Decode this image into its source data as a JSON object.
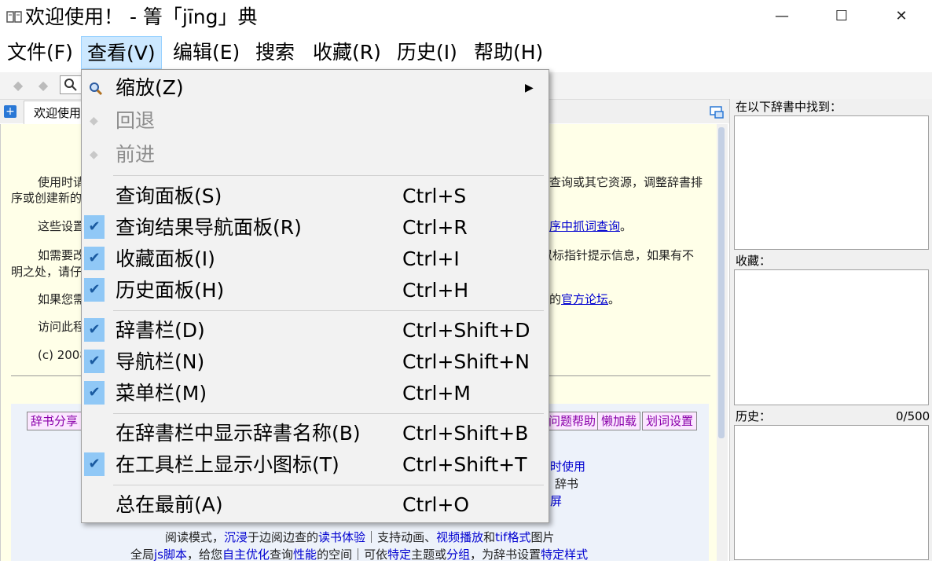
{
  "window": {
    "title": "欢迎使用！ - 箐「jīng」典",
    "controls": {
      "minimize": "—",
      "maximize": "☐",
      "close": "✕"
    }
  },
  "menubar": [
    {
      "label": "文件(F)"
    },
    {
      "label": "查看(V)"
    },
    {
      "label": "编辑(E)"
    },
    {
      "label": "搜索"
    },
    {
      "label": "收藏(R)"
    },
    {
      "label": "历史(I)"
    },
    {
      "label": "帮助(H)"
    }
  ],
  "tabs": {
    "welcome": "欢迎使用"
  },
  "content": {
    "p1_a": "使用时请",
    "p1_b": "查询或其它资源，调整辞書排",
    "p1_c": "序或创建新的",
    "p2_a": "这些设置",
    "p2_link": "序中抓词查询",
    "p2_end": "。",
    "p3_a": "如需要改",
    "p3_b": "鼠标指针提示信息，如果有不",
    "p3_c": "明之处，请仔",
    "p4_a": "如果您需",
    "p4_b": "的",
    "p4_link": "官方论坛",
    "p4_end": "。",
    "p5_a": "访问此程",
    "copyright": "(c) 2008",
    "buttons": {
      "share": "辞书分享",
      "help": "问题帮助",
      "lazy": "懒加载",
      "wordset": "划词设置"
    },
    "lines": {
      "l1": "时使用",
      "l2": "辞书",
      "l3": "屏",
      "l4_a": "阅读模式，",
      "l4_b": "沉浸",
      "l4_c": "于边阅边查的",
      "l4_d": "读书体验",
      "l4_e": "｜支持动画、",
      "l4_f": "视频播放",
      "l4_g": "和",
      "l4_h": "tif格式",
      "l4_i": "图片",
      "l5_a": "全局",
      "l5_b": "js脚本",
      "l5_c": "，给您",
      "l5_d": "自主优化",
      "l5_e": "查询",
      "l5_f": "性能",
      "l5_g": "的空间｜可依",
      "l5_h": "特定",
      "l5_i": "主题或",
      "l5_j": "分组",
      "l5_k": "，为辞书设置",
      "l5_l": "特定样式"
    }
  },
  "right_panel": {
    "found_label": "在以下辞書中找到：",
    "favorites_label": "收藏：",
    "history_label": "历史：",
    "history_count": "0/500"
  },
  "view_menu": {
    "items": [
      {
        "label": "缩放(Z)",
        "shortcut": "",
        "checked": false,
        "disabled": false,
        "submenu": true
      },
      {
        "label": "回退",
        "shortcut": "",
        "checked": false,
        "disabled": true
      },
      {
        "label": "前进",
        "shortcut": "",
        "checked": false,
        "disabled": true
      },
      {
        "label": "查询面板(S)",
        "shortcut": "Ctrl+S",
        "checked": false,
        "disabled": false
      },
      {
        "label": "查询结果导航面板(R)",
        "shortcut": "Ctrl+R",
        "checked": true,
        "disabled": false
      },
      {
        "label": "收藏面板(I)",
        "shortcut": "Ctrl+I",
        "checked": true,
        "disabled": false
      },
      {
        "label": "历史面板(H)",
        "shortcut": "Ctrl+H",
        "checked": true,
        "disabled": false
      },
      {
        "label": "辞書栏(D)",
        "shortcut": "Ctrl+Shift+D",
        "checked": true,
        "disabled": false
      },
      {
        "label": "导航栏(N)",
        "shortcut": "Ctrl+Shift+N",
        "checked": true,
        "disabled": false
      },
      {
        "label": "菜单栏(M)",
        "shortcut": "Ctrl+M",
        "checked": true,
        "disabled": false
      },
      {
        "label": "在辞書栏中显示辞書名称(B)",
        "shortcut": "Ctrl+Shift+B",
        "checked": false,
        "disabled": false
      },
      {
        "label": "在工具栏上显示小图标(T)",
        "shortcut": "Ctrl+Shift+T",
        "checked": true,
        "disabled": false
      },
      {
        "label": "总在最前(A)",
        "shortcut": "Ctrl+O",
        "checked": false,
        "disabled": false
      }
    ]
  },
  "colors": {
    "menu_highlight": "#cce8ff",
    "check_bg": "#90c8f6",
    "link": "#0000d0"
  }
}
